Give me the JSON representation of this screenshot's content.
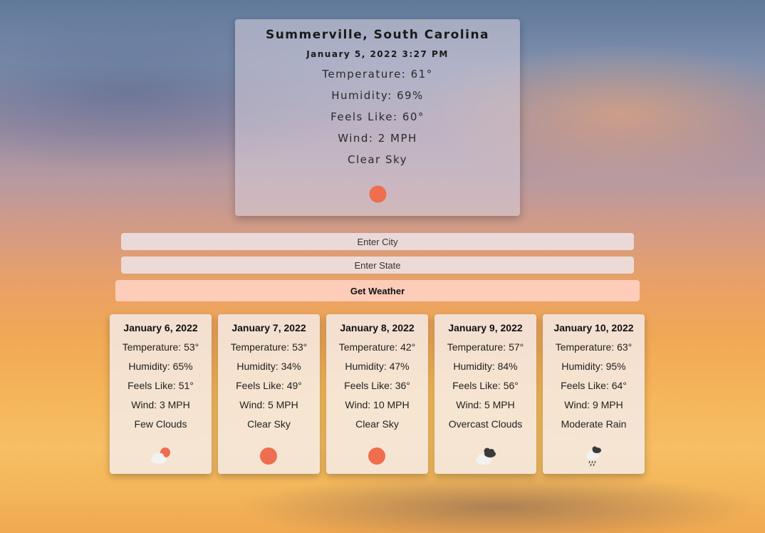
{
  "current": {
    "location": "Summerville, South Carolina",
    "datetime": "January 5, 2022 3:27 PM",
    "temperature": "Temperature: 61°",
    "humidity": "Humidity: 69%",
    "feels_like": "Feels Like: 60°",
    "wind": "Wind: 2 MPH",
    "description": "Clear Sky",
    "icon": "sun-icon"
  },
  "search": {
    "city_placeholder": "Enter City",
    "state_placeholder": "Enter State",
    "button_label": "Get Weather"
  },
  "forecast": [
    {
      "date": "January 6, 2022",
      "temperature": "Temperature: 53°",
      "humidity": "Humidity: 65%",
      "feels_like": "Feels Like: 51°",
      "wind": "Wind: 3 MPH",
      "description": "Few Clouds",
      "icon": "few-clouds-icon"
    },
    {
      "date": "January 7, 2022",
      "temperature": "Temperature: 53°",
      "humidity": "Humidity: 34%",
      "feels_like": "Feels Like: 49°",
      "wind": "Wind: 5 MPH",
      "description": "Clear Sky",
      "icon": "sun-icon"
    },
    {
      "date": "January 8, 2022",
      "temperature": "Temperature: 42°",
      "humidity": "Humidity: 47%",
      "feels_like": "Feels Like: 36°",
      "wind": "Wind: 10 MPH",
      "description": "Clear Sky",
      "icon": "sun-icon"
    },
    {
      "date": "January 9, 2022",
      "temperature": "Temperature: 57°",
      "humidity": "Humidity: 84%",
      "feels_like": "Feels Like: 56°",
      "wind": "Wind: 5 MPH",
      "description": "Overcast Clouds",
      "icon": "overcast-clouds-icon"
    },
    {
      "date": "January 10, 2022",
      "temperature": "Temperature: 63°",
      "humidity": "Humidity: 95%",
      "feels_like": "Feels Like: 64°",
      "wind": "Wind: 9 MPH",
      "description": "Moderate Rain",
      "icon": "rain-icon"
    }
  ],
  "colors": {
    "sun": "#ee6e4f",
    "dark_cloud": "#3a3a3a",
    "light_cloud": "#f2f2f2"
  }
}
